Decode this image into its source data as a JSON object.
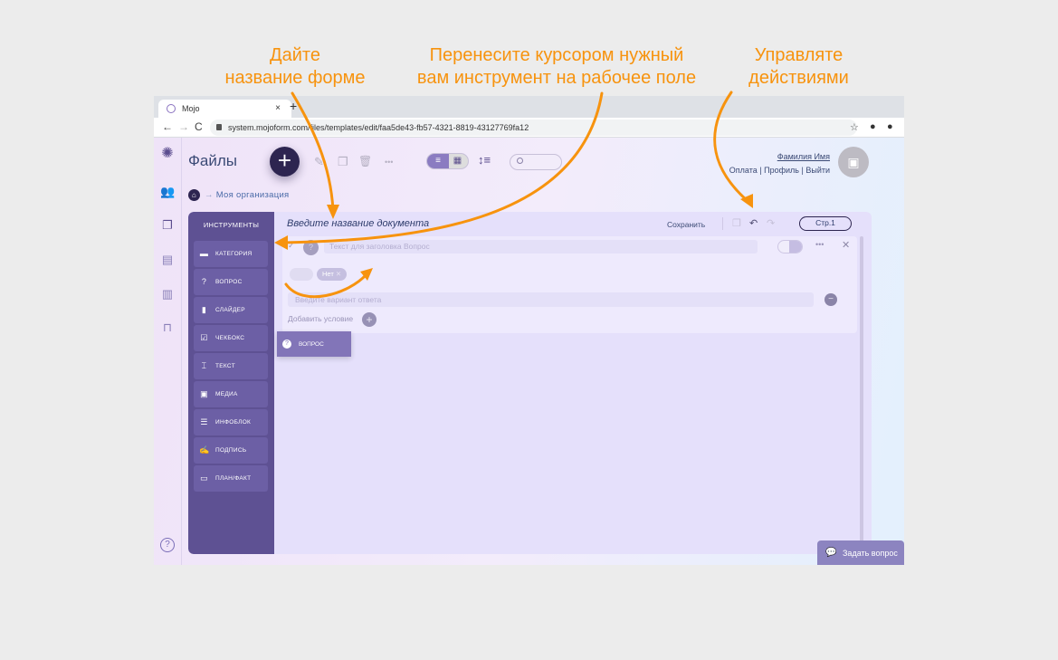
{
  "annotations": {
    "left": "Дайте\nназвание форме",
    "middle": "Перенесите курсором нужный\nвам инструмент на рабочее поле",
    "right": "Управляте\nдействиями",
    "accent_color": "#f7930e"
  },
  "browser": {
    "tab_title": "Mojo",
    "tab_close": "×",
    "new_tab": "+",
    "url": "system.mojoform.com/files/templates/edit/faa5de43-fb57-4321-8819-43127769fa12",
    "back": "←",
    "forward": "→",
    "reload": "C",
    "bookmark": "☆",
    "profile": "●",
    "extension": "●"
  },
  "app": {
    "page_title": "Файлы",
    "fab_label": "+",
    "toolbar": {
      "edit": "✎",
      "copy": "❐",
      "delete": "🗑",
      "more": "•••",
      "view_list": "≡",
      "view_grid": "▦",
      "sort": "↕≡"
    },
    "search": {
      "placeholder": ""
    },
    "user": {
      "name": "Фамилия Имя",
      "links": [
        "Оплата",
        "Профиль",
        "Выйти"
      ],
      "separator": "|"
    },
    "breadcrumb": {
      "arrow": "→",
      "label": "Моя организация"
    },
    "rail_icons": [
      "logo-icon",
      "users-icon",
      "files-icon",
      "document-icon",
      "chart-icon",
      "archive-icon"
    ],
    "help": "?",
    "ask_button": "Задать вопрос"
  },
  "editor": {
    "tools_title": "ИНСТРУМЕНТЫ",
    "tools": [
      {
        "label": "КАТЕГОРИЯ",
        "icon": "▬"
      },
      {
        "label": "ВОПРОС",
        "icon": "?"
      },
      {
        "label": "СЛАЙДЕР",
        "icon": "▮"
      },
      {
        "label": "ЧЕКБОКС",
        "icon": "☑"
      },
      {
        "label": "ТЕКСТ",
        "icon": "⌶"
      },
      {
        "label": "МЕДИА",
        "icon": "▣"
      },
      {
        "label": "ИНФОБЛОК",
        "icon": "☰"
      },
      {
        "label": "ПОДПИСЬ",
        "icon": "✍"
      },
      {
        "label": "ПЛАН/ФАКТ",
        "icon": "▭"
      }
    ],
    "drag_ghost": {
      "label": "ВОПРОС",
      "icon": "?"
    },
    "doc_title_placeholder": "Введите название документа",
    "save_label": "Сохранить",
    "actions": {
      "copy": "❐",
      "undo": "↶",
      "redo": "↷"
    },
    "page_button": "Стр.1",
    "question": {
      "check": "✓",
      "badge": "?",
      "title_placeholder": "Текст для заголовка Вопрос",
      "more": "•••",
      "close": "✕",
      "tag": "Нет",
      "tag_close": "✕",
      "answer_placeholder": "Введите вариант ответа",
      "answer_add": "−",
      "add_condition": "Добавить условие",
      "add_condition_icon": "+"
    }
  }
}
